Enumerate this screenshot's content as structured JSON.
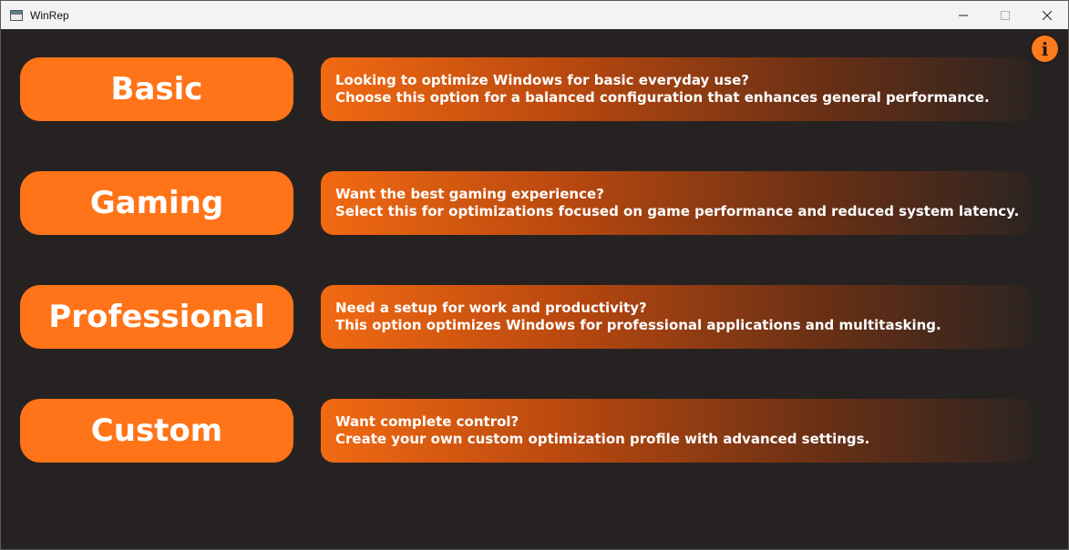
{
  "window": {
    "title": "WinRep",
    "controls": {
      "minimize": "minimize-icon",
      "maximize": "maximize-icon",
      "close": "close-icon"
    }
  },
  "info_button": {
    "icon": "info-icon",
    "glyph": "i"
  },
  "options": [
    {
      "label": "Basic",
      "line1": "Looking to optimize Windows for basic everyday use?",
      "line2": "Choose this option for a balanced configuration that enhances general performance."
    },
    {
      "label": "Gaming",
      "line1": "Want the best gaming experience?",
      "line2": "Select this for optimizations focused on game performance and reduced system latency."
    },
    {
      "label": "Professional",
      "line1": "Need a setup for work and productivity?",
      "line2": "This option optimizes Windows for professional applications and multitasking."
    },
    {
      "label": "Custom",
      "line1": "Want complete control?",
      "line2": "Create your own custom optimization profile with advanced settings."
    }
  ],
  "colors": {
    "accent": "#ff7418",
    "background": "#272222",
    "text": "#ffffff"
  }
}
